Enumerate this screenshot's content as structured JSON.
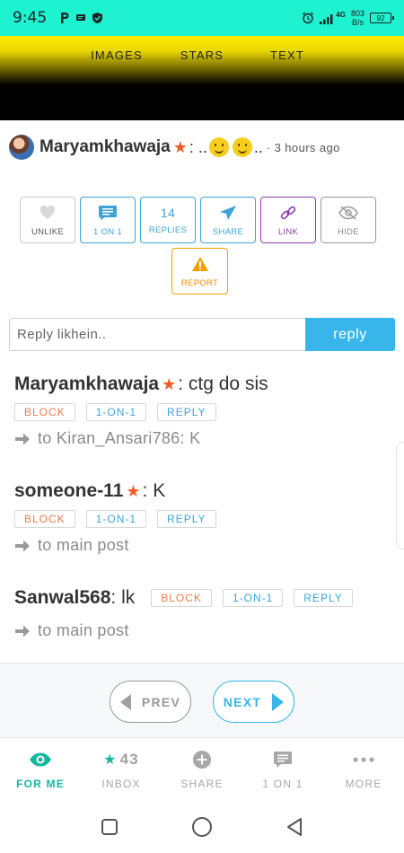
{
  "status_bar": {
    "time": "9:45",
    "network_type": "4G",
    "net_speed_value": "803",
    "net_speed_unit": "B/s",
    "battery": "92"
  },
  "banner": {
    "tabs": [
      "IMAGES",
      "STARS",
      "TEXT"
    ]
  },
  "post": {
    "username": "Maryamkhawaja",
    "text_prefix": ": ..",
    "text_suffix": "..",
    "time": "· 3 hours ago"
  },
  "actions": {
    "unlike": "UNLIKE",
    "one_on_one": "1 ON 1",
    "replies_count": "14",
    "replies": "REPLIES",
    "share": "SHARE",
    "link": "LINK",
    "hide": "HIDE",
    "report": "REPORT"
  },
  "reply_box": {
    "placeholder": "Reply likhein..",
    "button": "reply"
  },
  "replies": [
    {
      "username": "Maryamkhawaja",
      "message": ": ctg do sis",
      "block": "BLOCK",
      "one_on_one": "1-ON-1",
      "reply": "REPLY",
      "to": "to Kiran_Ansari786: K"
    },
    {
      "username": "someone-11",
      "message": ": K",
      "block": "BLOCK",
      "one_on_one": "1-ON-1",
      "reply": "REPLY",
      "to": "to main post"
    },
    {
      "username": "Sanwal568",
      "message": ": lk",
      "block": "BLOCK",
      "one_on_one": "1-ON-1",
      "reply": "REPLY",
      "to": "to main post"
    }
  ],
  "pager": {
    "prev": "PREV",
    "next": "NEXT"
  },
  "bottom_nav": {
    "for_me": "FOR ME",
    "inbox_count": "43",
    "inbox": "INBOX",
    "share": "SHARE",
    "one_on_one": "1 ON 1",
    "more": "MORE"
  },
  "colors": {
    "status_bar": "#1ef2d0",
    "accent_blue": "#38b6ea",
    "accent_green": "#15b89f",
    "star": "#f15a24",
    "report": "#f0a100",
    "link_purple": "#8d3ab0"
  }
}
